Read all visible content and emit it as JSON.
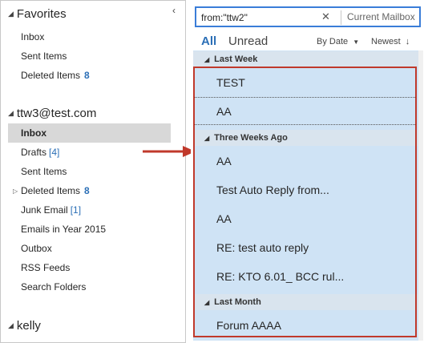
{
  "folders": {
    "favorites_label": "Favorites",
    "favorites_items": [
      {
        "label": "Inbox",
        "count": ""
      },
      {
        "label": "Sent Items",
        "count": ""
      },
      {
        "label": "Deleted Items",
        "count": "8"
      }
    ],
    "account_label": "ttw3@test.com",
    "account_items": [
      {
        "label": "Inbox",
        "count": ""
      },
      {
        "label": "Drafts",
        "count": "[4]"
      },
      {
        "label": "Sent Items",
        "count": ""
      },
      {
        "label": "Deleted Items",
        "count": "8"
      },
      {
        "label": "Junk Email",
        "count": "[1]"
      },
      {
        "label": "Emails in Year 2015",
        "count": ""
      },
      {
        "label": "Outbox",
        "count": ""
      },
      {
        "label": "RSS Feeds",
        "count": ""
      },
      {
        "label": "Search Folders",
        "count": ""
      }
    ],
    "second_account_label": "kelly"
  },
  "search": {
    "query": "from:\"ttw2\"",
    "scope": "Current Mailbox"
  },
  "filter": {
    "all": "All",
    "unread": "Unread",
    "sort_by": "By Date",
    "sort_order": "Newest"
  },
  "groups": [
    {
      "label": "Last Week",
      "messages": [
        "TEST",
        "AA"
      ]
    },
    {
      "label": "Three Weeks Ago",
      "messages": [
        "AA",
        "Test Auto Reply from...",
        "AA",
        "RE: test auto reply",
        "RE: KTO 6.01_ BCC rul..."
      ]
    },
    {
      "label": "Last Month",
      "messages": [
        "Forum AAAA"
      ]
    }
  ],
  "colors": {
    "accent_blue": "#2b6fb6",
    "selection_blue": "#cfe3f5",
    "highlight_red": "#c0392b"
  },
  "icons": {
    "collapse": "chevron-left-icon",
    "expand_group": "triangle-down-icon",
    "clear_search": "close-icon",
    "pointer": "red-arrow-icon"
  }
}
